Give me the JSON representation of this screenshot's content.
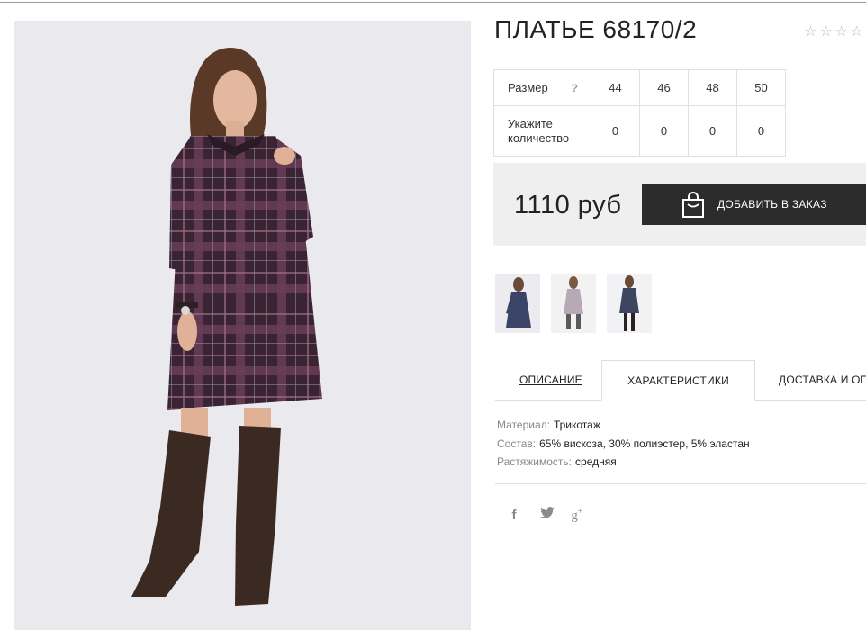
{
  "product": {
    "title": "ПЛАТЬЕ 68170/2",
    "rating": {
      "stars_filled": 0,
      "stars_total": 4,
      "star_glyph": "☆"
    }
  },
  "size_table": {
    "size_label": "Размер",
    "help_label": "?",
    "sizes": [
      "44",
      "46",
      "48",
      "50"
    ],
    "qty_label_line1": "Укажите",
    "qty_label_line2": "количество",
    "quantities": [
      "0",
      "0",
      "0",
      "0"
    ]
  },
  "order": {
    "price": "1110 руб",
    "button_label": "ДОБАВИТЬ В ЗАКАЗ",
    "button_icon": "shopping-bag-icon"
  },
  "thumbnails": [
    {
      "name": "thumb-front-dark"
    },
    {
      "name": "thumb-grey-dress"
    },
    {
      "name": "thumb-full-length"
    }
  ],
  "tabs": {
    "description": "ОПИСАНИЕ",
    "characteristics": "ХАРАКТЕРИСТИКИ",
    "delivery": "ДОСТАВКА И ОПЛАТА",
    "active": "characteristics"
  },
  "characteristics": {
    "material_label": "Материал:",
    "material_value": "Трикотаж",
    "composition_label": "Состав:",
    "composition_value": "65% вискоза, 30% полиэстер, 5% эластан",
    "stretch_label": "Растяжимость:",
    "stretch_value": "средняя"
  },
  "social": {
    "facebook_glyph": "f",
    "gplus_glyph": "g",
    "gplus_sup": "+"
  },
  "colors": {
    "button_bg": "#2c2c2c",
    "order_box_bg": "#efefef",
    "photo_bg": "#e9e9ee",
    "star": "#bdbdbd",
    "icon_grey": "#8a8a8a",
    "dress_base": "#3a2433",
    "dress_check": "#7e4a68",
    "boots": "#3b2a22"
  }
}
